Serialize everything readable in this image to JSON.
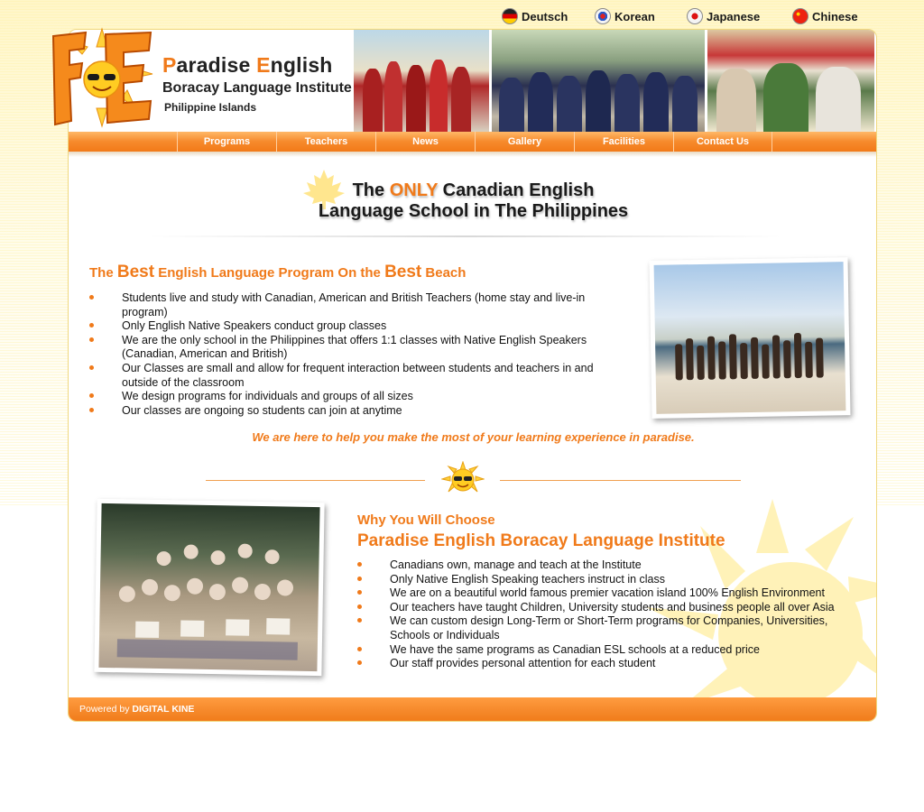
{
  "languages": [
    {
      "label": "Deutsch",
      "flag": "germany-flag-icon"
    },
    {
      "label": "Korean",
      "flag": "korea-flag-icon"
    },
    {
      "label": "Japanese",
      "flag": "japan-flag-icon"
    },
    {
      "label": "Chinese",
      "flag": "china-flag-icon"
    }
  ],
  "brand": {
    "title_p": "P",
    "title_rest1": "aradise ",
    "title_e": "E",
    "title_rest2": "nglish",
    "subtitle": "Boracay Language Institute",
    "location": "Philippine Islands",
    "logo_text": "PE"
  },
  "nav": [
    "Programs",
    "Teachers",
    "News",
    "Gallery",
    "Facilities",
    "Contact Us"
  ],
  "headline": {
    "line1_pre": "The ",
    "line1_only": "ONLY",
    "line1_post": " Canadian English",
    "line2": "Language School in The Philippines"
  },
  "section1": {
    "title_pre": "The ",
    "title_best1": "Best",
    "title_mid": " English Language Program On the ",
    "title_best2": "Best",
    "title_post": " Beach",
    "items": [
      "Students live and study with Canadian, American and British Teachers (home stay and live-in program)",
      "Only English Native Speakers conduct group classes",
      "We are the only school in the Philippines that offers 1:1 classes with Native English Speakers (Canadian, American and British)",
      "Our Classes are small and allow for frequent interaction between students and teachers in and outside of the classroom",
      "We design programs for individuals and groups of all sizes",
      "Our classes are ongoing so students can join at anytime"
    ]
  },
  "tagline": "We are here to help you make the most of your learning experience in paradise.",
  "section2": {
    "kicker": "Why You Will Choose",
    "title": "Paradise English Boracay Language Institute",
    "items": [
      "Canadians own, manage and teach at the Institute",
      "Only Native English Speaking teachers instruct in class",
      "We are on a beautiful world famous premier vacation island 100% English Environment",
      "Our teachers have taught Children, University students and business people all over Asia",
      "We can custom design Long-Term or Short-Term programs for Companies, Universities, Schools or Individuals",
      "We have the same programs as Canadian ESL schools at a reduced price",
      "Our staff provides personal attention for each student"
    ]
  },
  "footer": {
    "powered_by": "Powered by ",
    "company": "DIGITAL KINE"
  },
  "colors": {
    "accent": "#f07a1a",
    "nav_orange": "#f68a2c",
    "background_yellow": "#fff6c8"
  }
}
